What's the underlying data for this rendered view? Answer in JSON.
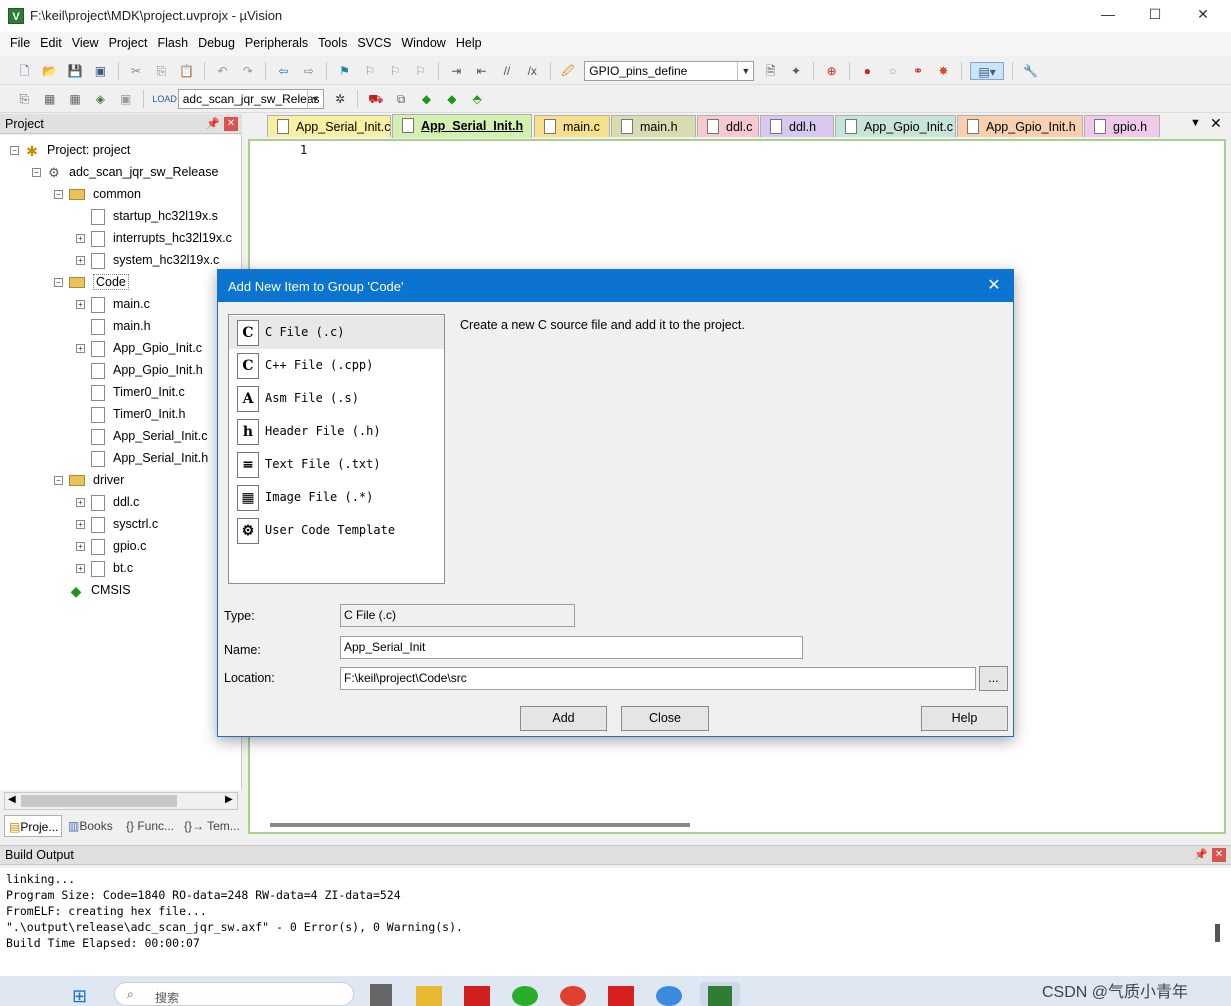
{
  "window": {
    "title": "F:\\keil\\project\\MDK\\project.uvprojx - µVision",
    "app_icon": "µVision-icon"
  },
  "menu": [
    "File",
    "Edit",
    "View",
    "Project",
    "Flash",
    "Debug",
    "Peripherals",
    "Tools",
    "SVCS",
    "Window",
    "Help"
  ],
  "toolbar1": {
    "combo_value": "GPIO_pins_define"
  },
  "toolbar2": {
    "target_combo": "adc_scan_jqr_sw_Releas"
  },
  "project_panel": {
    "title": "Project",
    "tree": [
      {
        "label": "Project: project",
        "level": 0,
        "icon": "project-icon",
        "expander": "−"
      },
      {
        "label": "adc_scan_jqr_sw_Release",
        "level": 1,
        "icon": "target-icon",
        "expander": "−"
      },
      {
        "label": "common",
        "level": 2,
        "icon": "folder-icon",
        "expander": "−"
      },
      {
        "label": "startup_hc32l19x.s",
        "level": 3,
        "icon": "file-icon",
        "expander": ""
      },
      {
        "label": "interrupts_hc32l19x.c",
        "level": 3,
        "icon": "file-icon",
        "expander": "+"
      },
      {
        "label": "system_hc32l19x.c",
        "level": 3,
        "icon": "file-icon",
        "expander": "+"
      },
      {
        "label": "Code",
        "level": 2,
        "icon": "folder-icon",
        "expander": "−"
      },
      {
        "label": "main.c",
        "level": 3,
        "icon": "file-icon",
        "expander": "+"
      },
      {
        "label": "main.h",
        "level": 3,
        "icon": "file-icon",
        "expander": ""
      },
      {
        "label": "App_Gpio_Init.c",
        "level": 3,
        "icon": "file-icon",
        "expander": "+"
      },
      {
        "label": "App_Gpio_Init.h",
        "level": 3,
        "icon": "file-icon",
        "expander": ""
      },
      {
        "label": "Timer0_Init.c",
        "level": 3,
        "icon": "file-icon",
        "expander": ""
      },
      {
        "label": "Timer0_Init.h",
        "level": 3,
        "icon": "file-icon",
        "expander": ""
      },
      {
        "label": "App_Serial_Init.c",
        "level": 3,
        "icon": "file-icon",
        "expander": ""
      },
      {
        "label": "App_Serial_Init.h",
        "level": 3,
        "icon": "file-icon",
        "expander": ""
      },
      {
        "label": "driver",
        "level": 2,
        "icon": "folder-icon",
        "expander": "−"
      },
      {
        "label": "ddl.c",
        "level": 3,
        "icon": "file-icon",
        "expander": "+"
      },
      {
        "label": "sysctrl.c",
        "level": 3,
        "icon": "file-icon",
        "expander": "+"
      },
      {
        "label": "gpio.c",
        "level": 3,
        "icon": "file-icon",
        "expander": "+"
      },
      {
        "label": "bt.c",
        "level": 3,
        "icon": "file-icon",
        "expander": "+"
      },
      {
        "label": "CMSIS",
        "level": 2,
        "icon": "component-icon",
        "expander": ""
      }
    ],
    "bottom_tabs": [
      "Proje...",
      "Books",
      "{} Func...",
      "{}→ Tem..."
    ]
  },
  "editor": {
    "tabs": [
      {
        "label": "App_Serial_Init.c",
        "color": "#f7f0a0"
      },
      {
        "label": "App_Serial_Init.h",
        "color": "#d4f0b0",
        "active": true
      },
      {
        "label": "main.c",
        "color": "#f7e08a"
      },
      {
        "label": "main.h",
        "color": "#d8dcb0"
      },
      {
        "label": "ddl.c",
        "color": "#f7c8d0"
      },
      {
        "label": "ddl.h",
        "color": "#d8c8f0"
      },
      {
        "label": "App_Gpio_Init.c",
        "color": "#c8e4d8"
      },
      {
        "label": "App_Gpio_Init.h",
        "color": "#f8d0b0"
      },
      {
        "label": "gpio.h",
        "color": "#f0c8e8"
      }
    ],
    "line_number": "1"
  },
  "build_output": {
    "title": "Build Output",
    "lines": [
      "linking...",
      "Program Size: Code=1840 RO-data=248 RW-data=4 ZI-data=524",
      "FromELF: creating hex file...",
      "\".\\output\\release\\adc_scan_jqr_sw.axf\" - 0 Error(s), 0 Warning(s).",
      "Build Time Elapsed:  00:00:07"
    ]
  },
  "dialog": {
    "title": "Add New Item to Group 'Code'",
    "items": [
      {
        "label": "C File (.c)",
        "glyph": "C",
        "selected": true
      },
      {
        "label": "C++ File (.cpp)",
        "glyph": "C"
      },
      {
        "label": "Asm File (.s)",
        "glyph": "A"
      },
      {
        "label": "Header File (.h)",
        "glyph": "h"
      },
      {
        "label": "Text File (.txt)",
        "glyph": "≡"
      },
      {
        "label": "Image File (.*)",
        "glyph": "▦"
      },
      {
        "label": "User Code Template",
        "glyph": "⚙"
      }
    ],
    "description": "Create a new C source file and add it to the project.",
    "type_label": "Type:",
    "type_value": "C File (.c)",
    "name_label": "Name:",
    "name_value": "App_Serial_Init",
    "location_label": "Location:",
    "location_value": "F:\\keil\\project\\Code\\src",
    "browse_label": "...",
    "add_label": "Add",
    "close_label": "Close",
    "help_label": "Help"
  },
  "taskbar": {
    "search_placeholder": "搜索",
    "watermark": "CSDN @气质小青年"
  }
}
